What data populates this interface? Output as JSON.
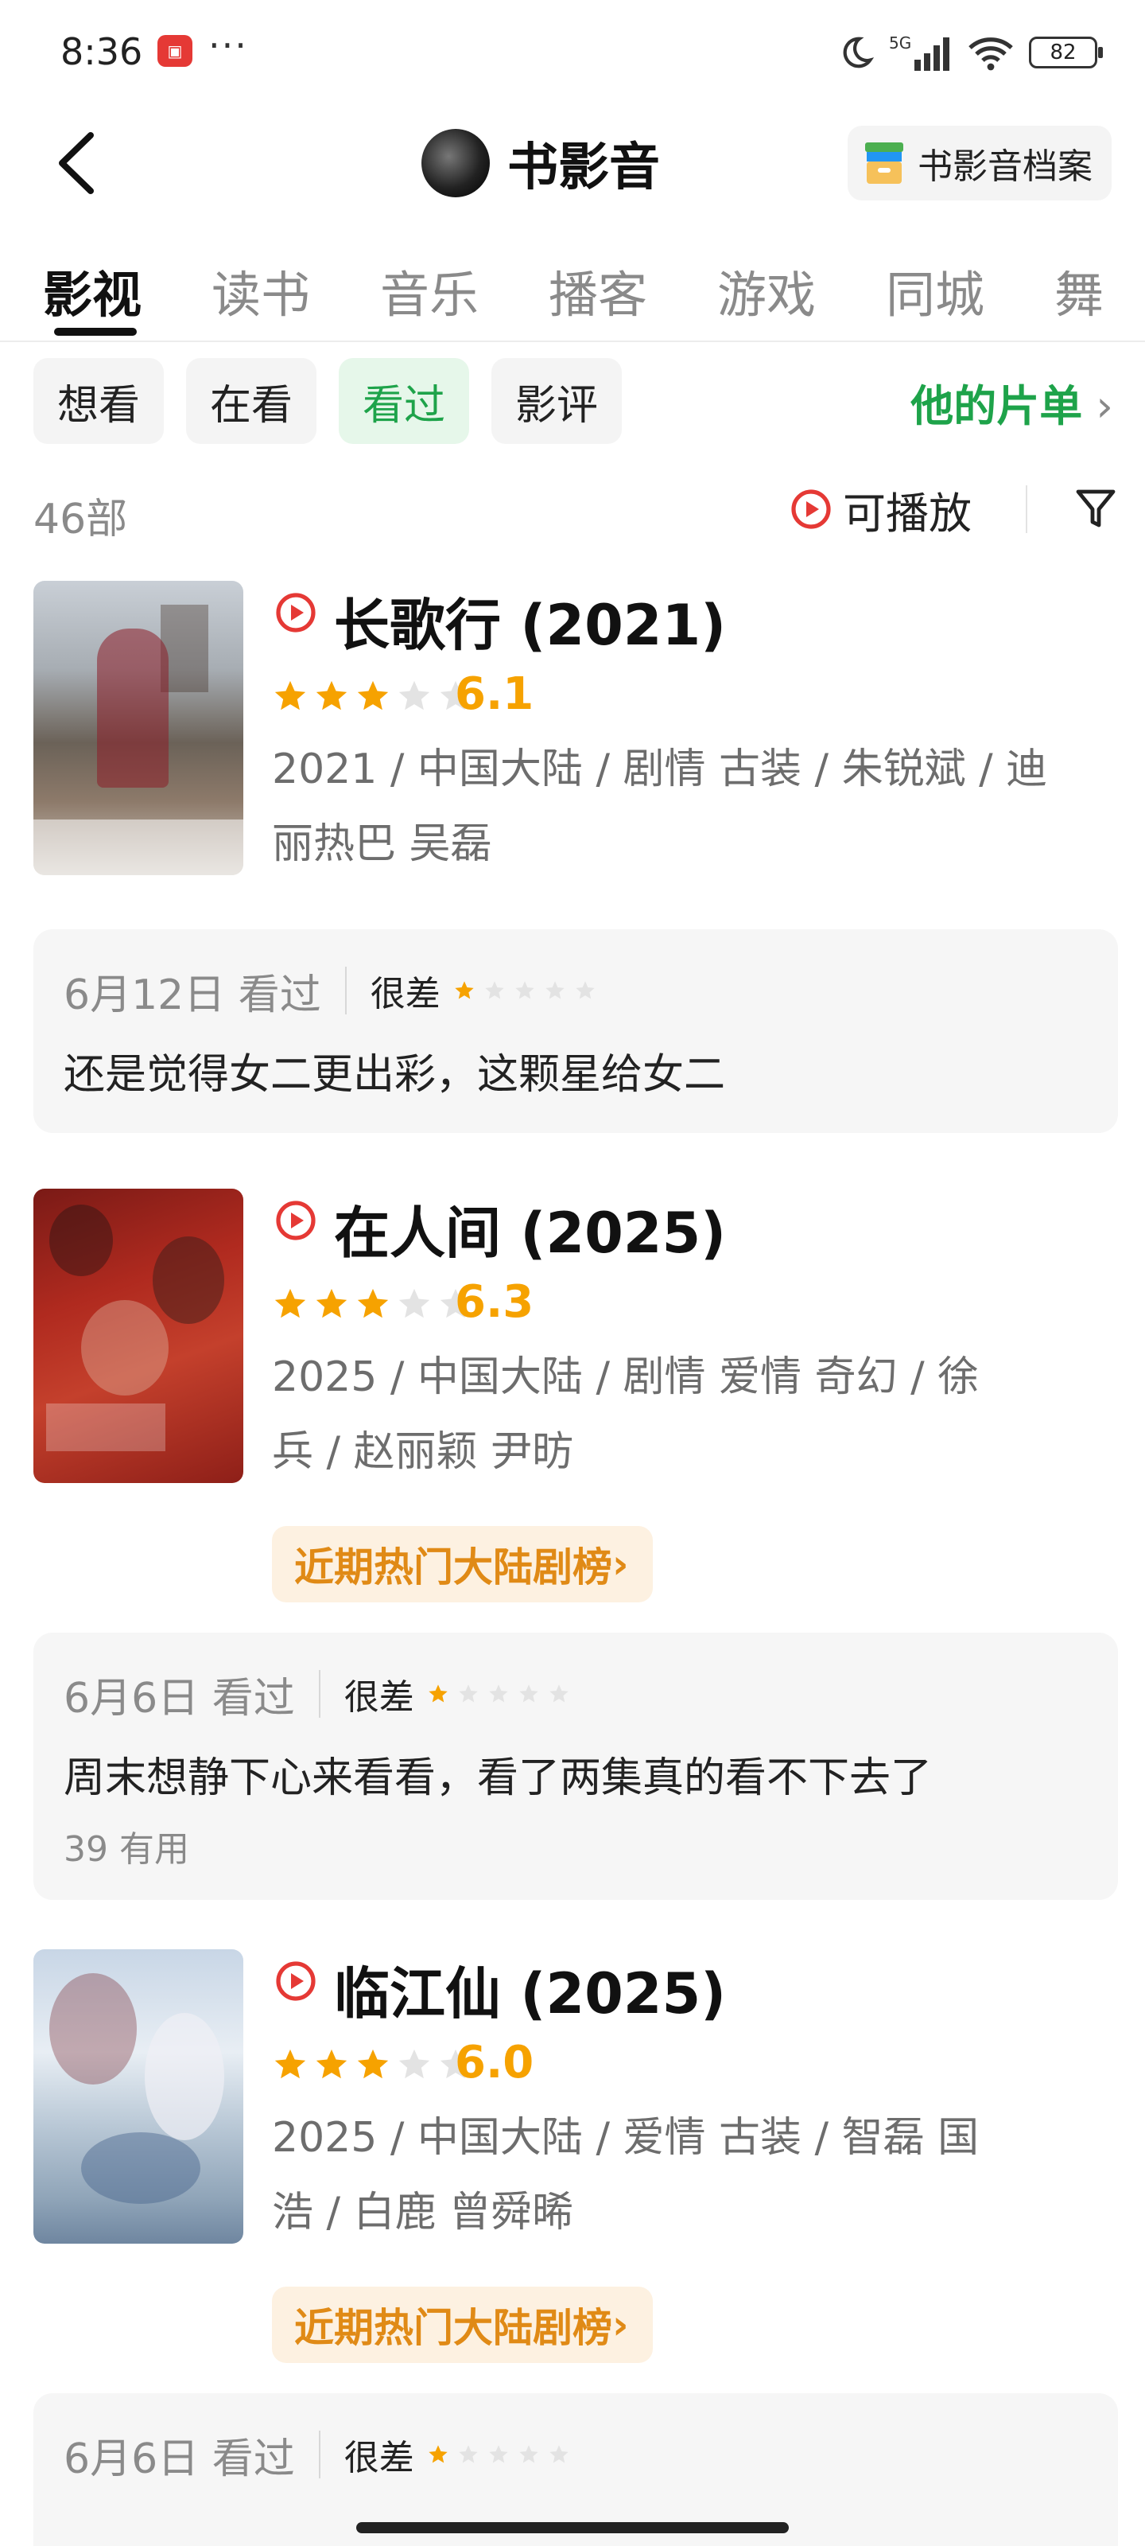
{
  "status_bar": {
    "time": "8:36",
    "app_icon": "notification-app-icon",
    "more": "···",
    "network": "5G",
    "battery": "82"
  },
  "header": {
    "title": "书影音",
    "archive_label": "书影音档案",
    "back_icon": "back-arrow-icon"
  },
  "tabs": [
    {
      "label": "影视",
      "active": true
    },
    {
      "label": "读书",
      "active": false
    },
    {
      "label": "音乐",
      "active": false
    },
    {
      "label": "播客",
      "active": false
    },
    {
      "label": "游戏",
      "active": false
    },
    {
      "label": "同城",
      "active": false
    },
    {
      "label": "舞",
      "active": false
    }
  ],
  "filters": [
    {
      "label": "想看",
      "active": false
    },
    {
      "label": "在看",
      "active": false
    },
    {
      "label": "看过",
      "active": true
    },
    {
      "label": "影评",
      "active": false
    }
  ],
  "playlist_link": "他的片单",
  "count_label": "46部",
  "playable_label": "可播放",
  "colors": {
    "accent_green": "#1ea34a",
    "star_orange": "#f6a200",
    "rank_orange": "#e08a16",
    "play_red": "#e53935"
  },
  "entries": [
    {
      "title": "长歌行 (2021)",
      "stars": 3,
      "score": "6.1",
      "meta_line1": "2021 / 中国大陆 / 剧情 古装 / 朱锐斌 / 迪",
      "meta_line2": "丽热巴 吴磊",
      "hotrank": "",
      "review": {
        "date": "6月12日 看过",
        "rating_label": "很差",
        "rating_stars": 1,
        "text": "还是觉得女二更出彩，这颗星给女二",
        "useful": ""
      }
    },
    {
      "title": "在人间 (2025)",
      "stars": 3,
      "score": "6.3",
      "meta_line1": "2025 / 中国大陆 / 剧情 爱情 奇幻 / 徐",
      "meta_line2": "兵 / 赵丽颖 尹昉",
      "hotrank": "近期热门大陆剧榜",
      "review": {
        "date": "6月6日 看过",
        "rating_label": "很差",
        "rating_stars": 1,
        "text": "周末想静下心来看看，看了两集真的看不下去了",
        "useful": "39 有用"
      }
    },
    {
      "title": "临江仙 (2025)",
      "stars": 3,
      "score": "6.0",
      "meta_line1": "2025 / 中国大陆 / 爱情 古装 / 智磊 国",
      "meta_line2": "浩 / 白鹿 曾舜晞",
      "hotrank": "近期热门大陆剧榜",
      "review": {
        "date": "6月6日 看过",
        "rating_label": "很差",
        "rating_stars": 1,
        "text": "",
        "useful": ""
      }
    }
  ]
}
